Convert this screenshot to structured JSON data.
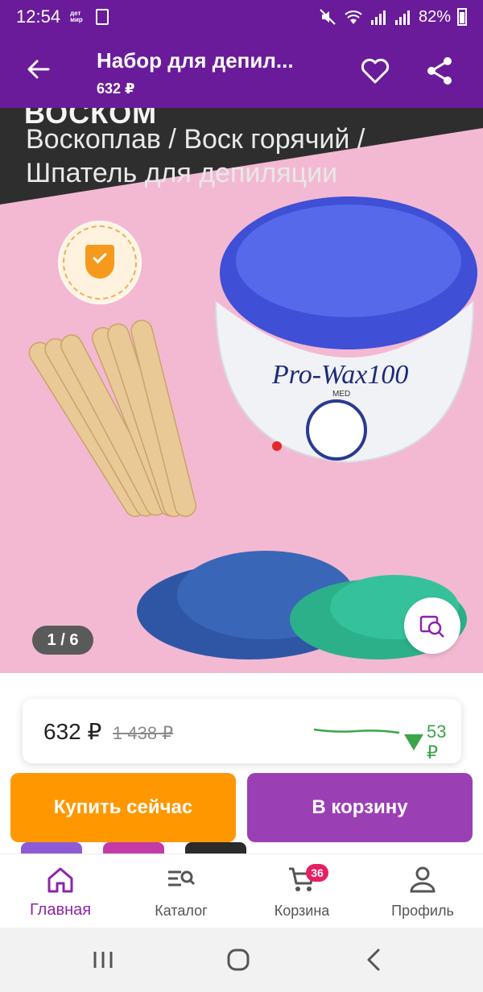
{
  "status_bar": {
    "time": "12:54",
    "mini_brand": "дет мир",
    "battery": "82%"
  },
  "app_bar": {
    "title": "Набор для депил...",
    "price": "632 ₽"
  },
  "gallery": {
    "headline": "ВОСКОМ",
    "line1": "Воскоплав / Воск горячий /",
    "line2": "Шпатель для депиляции",
    "device_label": "Pro-Wax100",
    "knob_label": "MED",
    "counter": "1 / 6"
  },
  "price_card": {
    "price": "632 ₽",
    "old_price": "1 438 ₽",
    "drop": "53 ₽"
  },
  "actions": {
    "buy_now": "Купить сейчас",
    "add_to_cart": "В корзину"
  },
  "tabs": [
    {
      "label": "Главная",
      "icon": "home-icon",
      "active": true
    },
    {
      "label": "Каталог",
      "icon": "catalog-search-icon"
    },
    {
      "label": "Корзина",
      "icon": "cart-icon",
      "badge": "36"
    },
    {
      "label": "Профиль",
      "icon": "profile-icon"
    }
  ],
  "colors": {
    "brand": "#6a1b9a",
    "accent": "#8e24aa",
    "buy": "#ff9800",
    "cart": "#9b3fb5",
    "price_drop": "#3aa54a"
  }
}
